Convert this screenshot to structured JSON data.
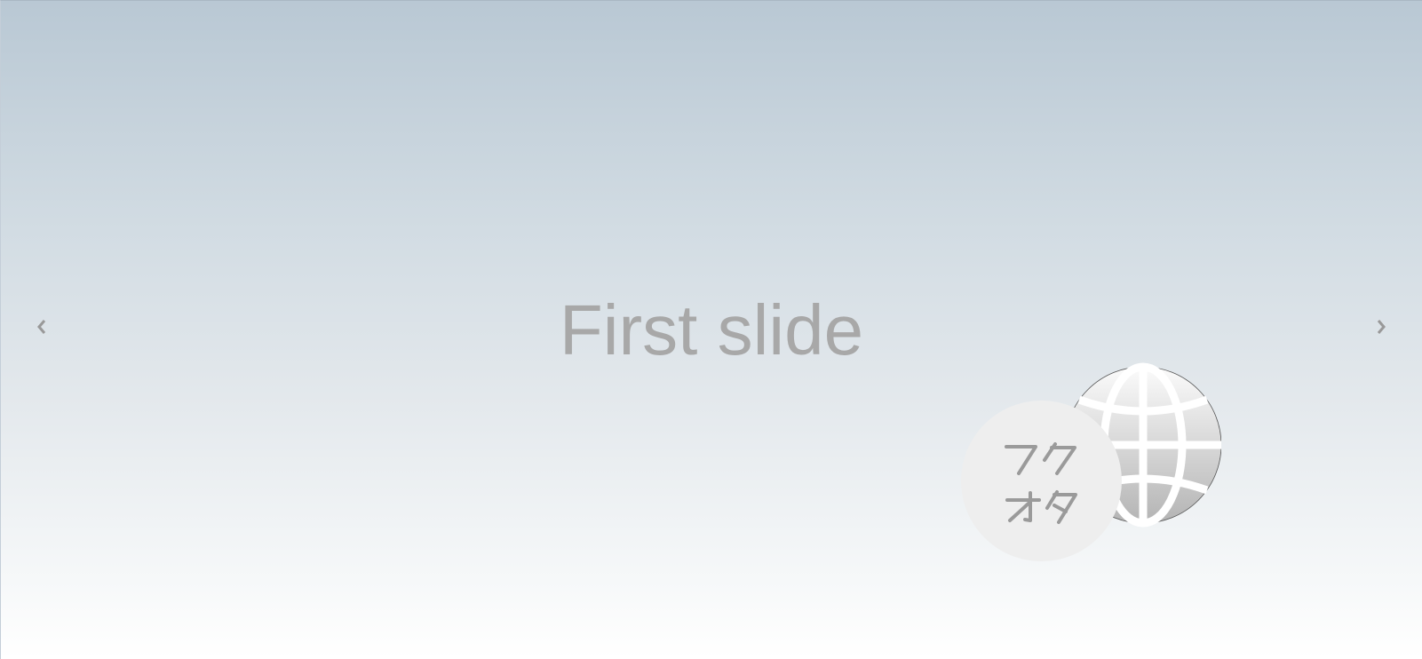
{
  "carousel": {
    "slide_label": "First slide",
    "prev_icon": "chevron-left-icon",
    "next_icon": "chevron-right-icon"
  },
  "widgets": {
    "globe_icon": "globe-icon",
    "badge_logo": "otaku-logo-badge",
    "badge_text": "フクオタ"
  },
  "colors": {
    "gradient_top": "#b9c8d4",
    "gradient_bottom": "#ffffff",
    "caption_text": "#a8a8a8",
    "arrow": "#999999",
    "badge_background": "#eeeeee"
  }
}
